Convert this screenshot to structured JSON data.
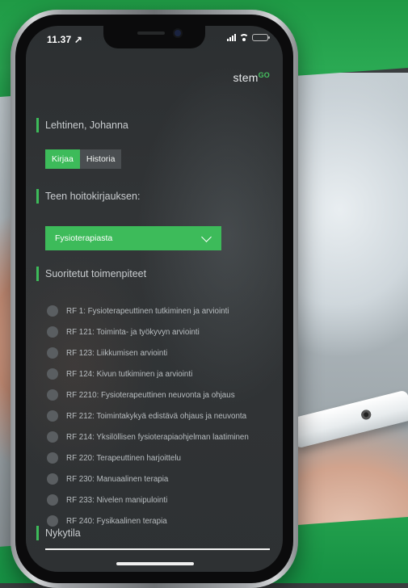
{
  "status_bar": {
    "time": "11.37 ↗"
  },
  "app": {
    "logo_text": "stem",
    "logo_sup": "GO",
    "patient_name": "Lehtinen, Johanna",
    "tabs": [
      {
        "label": "Kirjaa",
        "active": true
      },
      {
        "label": "Historia",
        "active": false
      }
    ],
    "entry_heading": "Teen hoitokirjauksen:",
    "entry_select_value": "Fysioterapiasta",
    "procedures_heading": "Suoritetut toimenpiteet",
    "procedures": [
      "RF 1: Fysioterapeuttinen tutkiminen ja arviointi",
      "RF 121: Toiminta- ja työkyvyn arviointi",
      "RF 123: Liikkumisen arviointi",
      "RF 124: Kivun tutkiminen ja arviointi",
      "RF 2210: Fysioterapeuttinen neuvonta ja ohjaus",
      "RF 212: Toimintakykyä edistävä ohjaus ja neuvonta",
      "RF 214: Yksilöllisen fysioterapiaohjelman laatiminen",
      "RF 220: Terapeuttinen harjoittelu",
      "RF 230: Manuaalinen terapia",
      "RF 233: Nivelen manipulointi",
      "RF 240: Fysikaalinen terapia"
    ],
    "status_heading": "Nykytila"
  },
  "colors": {
    "accent": "#3dbb5a",
    "brand_green": "#23a04c"
  }
}
